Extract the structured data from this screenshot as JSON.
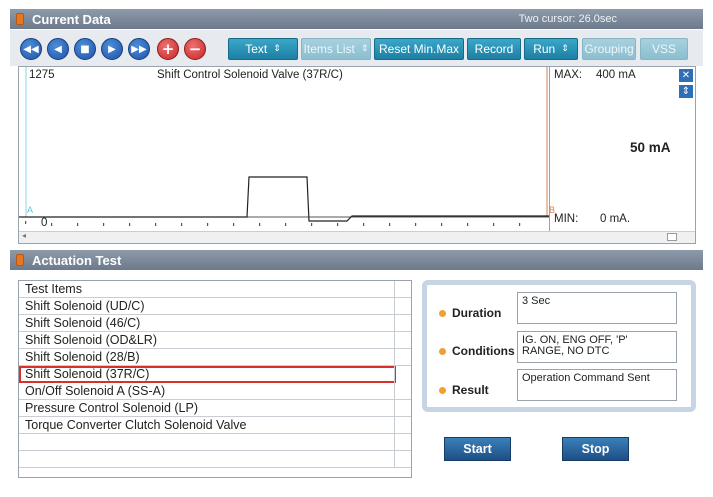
{
  "current_data": {
    "title": "Current Data",
    "cursor_info": "Two cursor: 26.0sec"
  },
  "toolbar": {
    "nav_buttons": [
      "◀◀",
      "◀",
      "■",
      "▶",
      "▶▶",
      "+",
      "−"
    ],
    "text_label": "Text",
    "items_list_label": "Items List",
    "reset_label": "Reset Min.Max",
    "record_label": "Record",
    "run_label": "Run",
    "grouping_label": "Grouping",
    "vss_label": "VSS",
    "spin_glyph": "⇕"
  },
  "graph": {
    "item_number": "1275",
    "item_name": "Shift Control Solenoid Valve (37R/C)",
    "max_label": "MAX:",
    "max_value": "400 mA",
    "current_value": "50 mA",
    "min_label": "MIN:",
    "min_value": "0 mA.",
    "zero_label": "0",
    "cursor_a": "A",
    "cursor_b": "B",
    "close_glyph": "✕",
    "fit_glyph": "⇕"
  },
  "actuation": {
    "title": "Actuation Test",
    "column_header": "Test Items",
    "items": [
      "Shift Solenoid (UD/C)",
      "Shift Solenoid (46/C)",
      "Shift Solenoid (OD&LR)",
      "Shift Solenoid (28/B)",
      "Shift Solenoid (37R/C)",
      "On/Off Solenoid A (SS-A)",
      "Pressure Control Solenoid (LP)",
      "Torque Converter Clutch Solenoid Valve"
    ],
    "selected_index": 4,
    "duration_label": "Duration",
    "duration_value": "3 Sec",
    "conditions_label": "Conditions",
    "conditions_value": "IG. ON, ENG OFF, 'P' RANGE, NO DTC",
    "result_label": "Result",
    "result_value": "Operation Command Sent",
    "start_label": "Start",
    "stop_label": "Stop"
  },
  "colors": {
    "accent": "#1d7fa4",
    "selection": "#d9302a",
    "trace": "#222222"
  }
}
